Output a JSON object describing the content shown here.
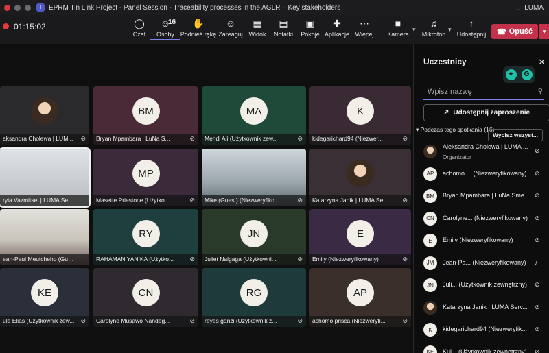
{
  "window": {
    "title": "EPRM Tin Link Project - Panel Session - Traceability processes in the AGLR – Key stakeholders",
    "org": "LUMA",
    "more": "..."
  },
  "toolbar": {
    "timer": "01:15:02",
    "people_count": "16",
    "buttons": [
      {
        "label": "Czat",
        "icon": "chat-icon",
        "glyph": "◯"
      },
      {
        "label": "Osoby",
        "icon": "people-icon",
        "glyph": "☺"
      },
      {
        "label": "Podnieś rękę",
        "icon": "raise-hand-icon",
        "glyph": "✋"
      },
      {
        "label": "Zareaguj",
        "icon": "react-icon",
        "glyph": "☺"
      },
      {
        "label": "Widok",
        "icon": "view-icon",
        "glyph": "▦"
      },
      {
        "label": "Notatki",
        "icon": "notes-icon",
        "glyph": "▤"
      },
      {
        "label": "Pokoje",
        "icon": "rooms-icon",
        "glyph": "▣"
      },
      {
        "label": "Aplikacje",
        "icon": "apps-icon",
        "glyph": "✚"
      },
      {
        "label": "Więcej",
        "icon": "more-icon",
        "glyph": "⋯"
      },
      {
        "label": "Kamera",
        "icon": "camera-icon",
        "glyph": "■"
      },
      {
        "label": "Mikrofon",
        "icon": "microphone-icon",
        "glyph": "♫"
      },
      {
        "label": "Udostępnij",
        "icon": "share-screen-icon",
        "glyph": "↑"
      }
    ],
    "leave_label": "Opuść",
    "leave_color": "#c4314b"
  },
  "grid": {
    "tiles": [
      {
        "name": "aksandra Cholewa | LUM...",
        "initials": "",
        "kind": "photo",
        "muted": true
      },
      {
        "name": "Bryan Mpambara | LuNa S...",
        "initials": "BM",
        "kind": "avatar",
        "bg": "#4a2a36",
        "muted": true
      },
      {
        "name": "Mehdi Ali (Użytkownik zew...",
        "initials": "MA",
        "kind": "avatar",
        "bg": "#1f4a3a",
        "muted": true
      },
      {
        "name": "kidegarichard94 (Niezwer...",
        "initials": "K",
        "kind": "avatar",
        "bg": "#3a2a33",
        "muted": true
      },
      {
        "name": "ryia Vazmitsel | LUMA Servi...",
        "initials": "",
        "kind": "video",
        "muted": false
      },
      {
        "name": "Masette Priestone (Użytko...",
        "initials": "MP",
        "kind": "avatar",
        "bg": "#3b2a3a",
        "muted": true
      },
      {
        "name": "Mike (Guest) (Niezweryfiko...",
        "initials": "",
        "kind": "video2",
        "muted": true
      },
      {
        "name": "Katarzyna Janik | LUMA Se...",
        "initials": "",
        "kind": "photo",
        "bg": "#3a2f35",
        "muted": true
      },
      {
        "name": "ean-Paul Meutcheho (Guest)",
        "initials": "",
        "kind": "video3",
        "muted": false
      },
      {
        "name": "RAHAMAN YANIKA (Użytko...",
        "initials": "RY",
        "kind": "avatar",
        "bg": "#1f3f3f",
        "muted": true
      },
      {
        "name": "Juliet Nalgaga (Użytkowni...",
        "initials": "JN",
        "kind": "avatar",
        "bg": "#2a3a2a",
        "muted": true
      },
      {
        "name": "Emily (Niezweryfikowany)",
        "initials": "E",
        "kind": "avatar",
        "bg": "#3a2a44",
        "muted": true
      },
      {
        "name": "ule Elias (Użytkownik zew...",
        "initials": "KE",
        "kind": "avatar",
        "bg": "#2a2f3a",
        "muted": true
      },
      {
        "name": "Carolyne Musawo Nandeg...",
        "initials": "CN",
        "kind": "avatar",
        "bg": "#2e2a2f",
        "muted": true
      },
      {
        "name": "reyes ganzi (Użytkownik z...",
        "initials": "RG",
        "kind": "avatar",
        "bg": "#1f3a3a",
        "muted": true
      },
      {
        "name": "achomo prisca (Niezweryfi...",
        "initials": "AP",
        "kind": "avatar",
        "bg": "#3a2f2a",
        "muted": true
      }
    ]
  },
  "panel": {
    "title": "Uczestnicy",
    "close": "✕",
    "search_placeholder": "Wpisz nazwę",
    "share_invite": "Udostępnij zaproszenie",
    "section_label": "Podczas tego spotkania (16)",
    "mute_all": "Wycisz wszyst...",
    "participants": [
      {
        "name": "Aleksandra Cholewa | LUMA ...",
        "role": "Organizator",
        "initials": "",
        "photo": true,
        "mic": "⊘"
      },
      {
        "name": "achomo ... (Niezweryfikowany)",
        "role": "",
        "initials": "AP",
        "photo": false,
        "mic": "⊘"
      },
      {
        "name": "Bryan Mpambara | LuNa Sme...",
        "role": "",
        "initials": "BM",
        "photo": false,
        "mic": "⊘"
      },
      {
        "name": "Carolyne... (Niezweryfikowany)",
        "role": "",
        "initials": "CN",
        "photo": false,
        "mic": "⊘"
      },
      {
        "name": "Emily (Niezweryfikowany)",
        "role": "",
        "initials": "E",
        "photo": false,
        "mic": "⊘"
      },
      {
        "name": "Jean-Pa... (Niezweryfikowany)",
        "role": "",
        "initials": "JM",
        "photo": false,
        "mic": "♪"
      },
      {
        "name": "Juli... (Użytkownik zewnętrzny)",
        "role": "",
        "initials": "JN",
        "photo": false,
        "mic": "⊘"
      },
      {
        "name": "Katarzyna Janik | LUMA Serv...",
        "role": "",
        "initials": "",
        "photo": true,
        "mic": "⊘"
      },
      {
        "name": "kidegarichard94 (Niezweryfik...",
        "role": "",
        "initials": "K",
        "photo": false,
        "mic": "⊘"
      },
      {
        "name": "Kul... (Użytkownik zewnętrzny)",
        "role": "",
        "initials": "KE",
        "photo": false,
        "mic": "⊘"
      }
    ]
  }
}
